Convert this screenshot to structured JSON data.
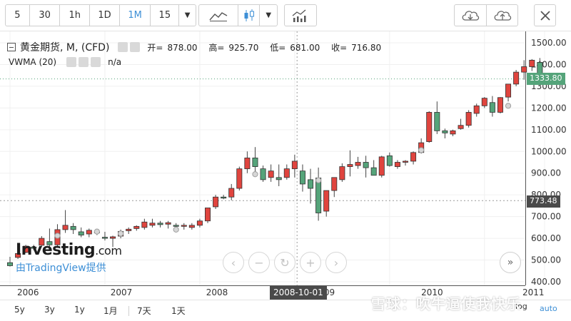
{
  "toolbar": {
    "intervals": [
      "5",
      "30",
      "1h",
      "1D",
      "1M",
      "15"
    ],
    "active_interval": "1M",
    "caret": "▼"
  },
  "legend": {
    "symbol": "黄金期货, M, (CFD)",
    "ohlc": [
      {
        "label": "开=",
        "value": "878.00"
      },
      {
        "label": "高=",
        "value": "925.70"
      },
      {
        "label": "低=",
        "value": "681.00"
      },
      {
        "label": "收=",
        "value": "716.80"
      }
    ],
    "indicator": "VWMA (20)",
    "indicator_value": "n/a"
  },
  "watermark": {
    "brand": "Investing",
    "brand_suffix": ".com",
    "provider": "由TradingView提供"
  },
  "price_axis": {
    "ticks": [
      "1500.00",
      "1400.00",
      "1300.00",
      "1200.00",
      "1100.00",
      "1000.00",
      "900.00",
      "800.00",
      "700.00",
      "600.00",
      "500.00",
      "400.00"
    ],
    "last_price": "1333.80",
    "cursor_price": "773.48"
  },
  "time_axis": {
    "labels": [
      "2006",
      "2007",
      "2008",
      "09",
      "2010",
      "2011"
    ],
    "cursor_label": "2008-10-01"
  },
  "range_bar": {
    "ranges": [
      "5y",
      "3y",
      "1y",
      "1月",
      "7天",
      "1天"
    ],
    "log_label": "log",
    "auto_label": "auto"
  },
  "overlay_text": "雪球：吹牛逼使我快乐",
  "colors": {
    "up": "#55a47a",
    "down": "#e0443e",
    "accent": "#3d8fd6",
    "last_price_bg": "#55a47a",
    "cursor_bg": "#4a4a4a"
  },
  "chart_data": {
    "type": "candlestick",
    "interval": "monthly",
    "ylim": [
      400,
      1500
    ],
    "candles": [
      {
        "o": 488,
        "h": 515,
        "l": 470,
        "c": 474
      },
      {
        "o": 512,
        "h": 535,
        "l": 505,
        "c": 530
      },
      {
        "o": 535,
        "h": 570,
        "l": 532,
        "c": 564
      },
      {
        "o": 560,
        "h": 570,
        "l": 545,
        "c": 554
      },
      {
        "o": 568,
        "h": 610,
        "l": 560,
        "c": 600
      },
      {
        "o": 585,
        "h": 645,
        "l": 560,
        "c": 570
      },
      {
        "o": 570,
        "h": 665,
        "l": 560,
        "c": 640
      },
      {
        "o": 640,
        "h": 730,
        "l": 625,
        "c": 660
      },
      {
        "o": 655,
        "h": 670,
        "l": 620,
        "c": 640
      },
      {
        "o": 630,
        "h": 650,
        "l": 605,
        "c": 615
      },
      {
        "o": 620,
        "h": 645,
        "l": 605,
        "c": 637
      },
      {
        "o": 630,
        "h": 640,
        "l": 615,
        "c": 625
      },
      {
        "o": 605,
        "h": 630,
        "l": 590,
        "c": 600
      },
      {
        "o": 600,
        "h": 612,
        "l": 560,
        "c": 607
      },
      {
        "o": 610,
        "h": 640,
        "l": 600,
        "c": 632
      },
      {
        "o": 635,
        "h": 650,
        "l": 620,
        "c": 642
      },
      {
        "o": 645,
        "h": 660,
        "l": 635,
        "c": 655
      },
      {
        "o": 650,
        "h": 690,
        "l": 640,
        "c": 675
      },
      {
        "o": 660,
        "h": 690,
        "l": 650,
        "c": 670
      },
      {
        "o": 670,
        "h": 680,
        "l": 650,
        "c": 663
      },
      {
        "o": 665,
        "h": 680,
        "l": 645,
        "c": 672
      },
      {
        "o": 660,
        "h": 670,
        "l": 640,
        "c": 655
      },
      {
        "o": 655,
        "h": 670,
        "l": 640,
        "c": 660
      },
      {
        "o": 650,
        "h": 670,
        "l": 640,
        "c": 660
      },
      {
        "o": 660,
        "h": 690,
        "l": 650,
        "c": 680
      },
      {
        "o": 680,
        "h": 740,
        "l": 670,
        "c": 740
      },
      {
        "o": 745,
        "h": 800,
        "l": 735,
        "c": 790
      },
      {
        "o": 790,
        "h": 800,
        "l": 780,
        "c": 785
      },
      {
        "o": 790,
        "h": 850,
        "l": 775,
        "c": 830
      },
      {
        "o": 830,
        "h": 930,
        "l": 820,
        "c": 920
      },
      {
        "o": 920,
        "h": 1000,
        "l": 900,
        "c": 970
      },
      {
        "o": 970,
        "h": 1020,
        "l": 900,
        "c": 930
      },
      {
        "o": 920,
        "h": 935,
        "l": 860,
        "c": 870
      },
      {
        "o": 880,
        "h": 940,
        "l": 860,
        "c": 910
      },
      {
        "o": 880,
        "h": 940,
        "l": 840,
        "c": 870
      },
      {
        "o": 880,
        "h": 940,
        "l": 870,
        "c": 920
      },
      {
        "o": 920,
        "h": 985,
        "l": 880,
        "c": 955
      },
      {
        "o": 910,
        "h": 940,
        "l": 815,
        "c": 850
      },
      {
        "o": 870,
        "h": 920,
        "l": 760,
        "c": 830
      },
      {
        "o": 878,
        "h": 925.7,
        "l": 681,
        "c": 716.8
      },
      {
        "o": 725,
        "h": 815,
        "l": 700,
        "c": 820
      },
      {
        "o": 820,
        "h": 880,
        "l": 790,
        "c": 880
      },
      {
        "o": 870,
        "h": 945,
        "l": 860,
        "c": 930
      },
      {
        "o": 930,
        "h": 1005,
        "l": 885,
        "c": 940
      },
      {
        "o": 935,
        "h": 975,
        "l": 920,
        "c": 950
      },
      {
        "o": 950,
        "h": 980,
        "l": 880,
        "c": 925
      },
      {
        "o": 925,
        "h": 960,
        "l": 890,
        "c": 890
      },
      {
        "o": 890,
        "h": 980,
        "l": 880,
        "c": 975
      },
      {
        "o": 980,
        "h": 995,
        "l": 930,
        "c": 935
      },
      {
        "o": 930,
        "h": 960,
        "l": 920,
        "c": 950
      },
      {
        "o": 950,
        "h": 960,
        "l": 935,
        "c": 955
      },
      {
        "o": 955,
        "h": 1000,
        "l": 940,
        "c": 995
      },
      {
        "o": 995,
        "h": 1060,
        "l": 990,
        "c": 1040
      },
      {
        "o": 1045,
        "h": 1185,
        "l": 1040,
        "c": 1180
      },
      {
        "o": 1180,
        "h": 1230,
        "l": 1080,
        "c": 1095
      },
      {
        "o": 1095,
        "h": 1105,
        "l": 1060,
        "c": 1085
      },
      {
        "o": 1080,
        "h": 1100,
        "l": 1070,
        "c": 1095
      },
      {
        "o": 1105,
        "h": 1150,
        "l": 1100,
        "c": 1120
      },
      {
        "o": 1120,
        "h": 1190,
        "l": 1110,
        "c": 1180
      },
      {
        "o": 1175,
        "h": 1220,
        "l": 1160,
        "c": 1210
      },
      {
        "o": 1210,
        "h": 1250,
        "l": 1200,
        "c": 1245
      },
      {
        "o": 1225,
        "h": 1255,
        "l": 1160,
        "c": 1180
      },
      {
        "o": 1180,
        "h": 1250,
        "l": 1175,
        "c": 1248
      },
      {
        "o": 1250,
        "h": 1310,
        "l": 1230,
        "c": 1310
      },
      {
        "o": 1310,
        "h": 1375,
        "l": 1300,
        "c": 1365
      },
      {
        "o": 1365,
        "h": 1420,
        "l": 1330,
        "c": 1390
      },
      {
        "o": 1390,
        "h": 1425,
        "l": 1370,
        "c": 1420
      },
      {
        "o": 1410,
        "h": 1430,
        "l": 1310,
        "c": 1334
      }
    ],
    "vwma_points": [
      {
        "i": 6,
        "v": 612
      },
      {
        "i": 11,
        "v": 631
      },
      {
        "i": 14,
        "v": 622
      },
      {
        "i": 21,
        "v": 640
      },
      {
        "i": 31,
        "v": 895
      },
      {
        "i": 39,
        "v": 867
      },
      {
        "i": 52,
        "v": 1006
      },
      {
        "i": 63,
        "v": 1210
      }
    ]
  }
}
